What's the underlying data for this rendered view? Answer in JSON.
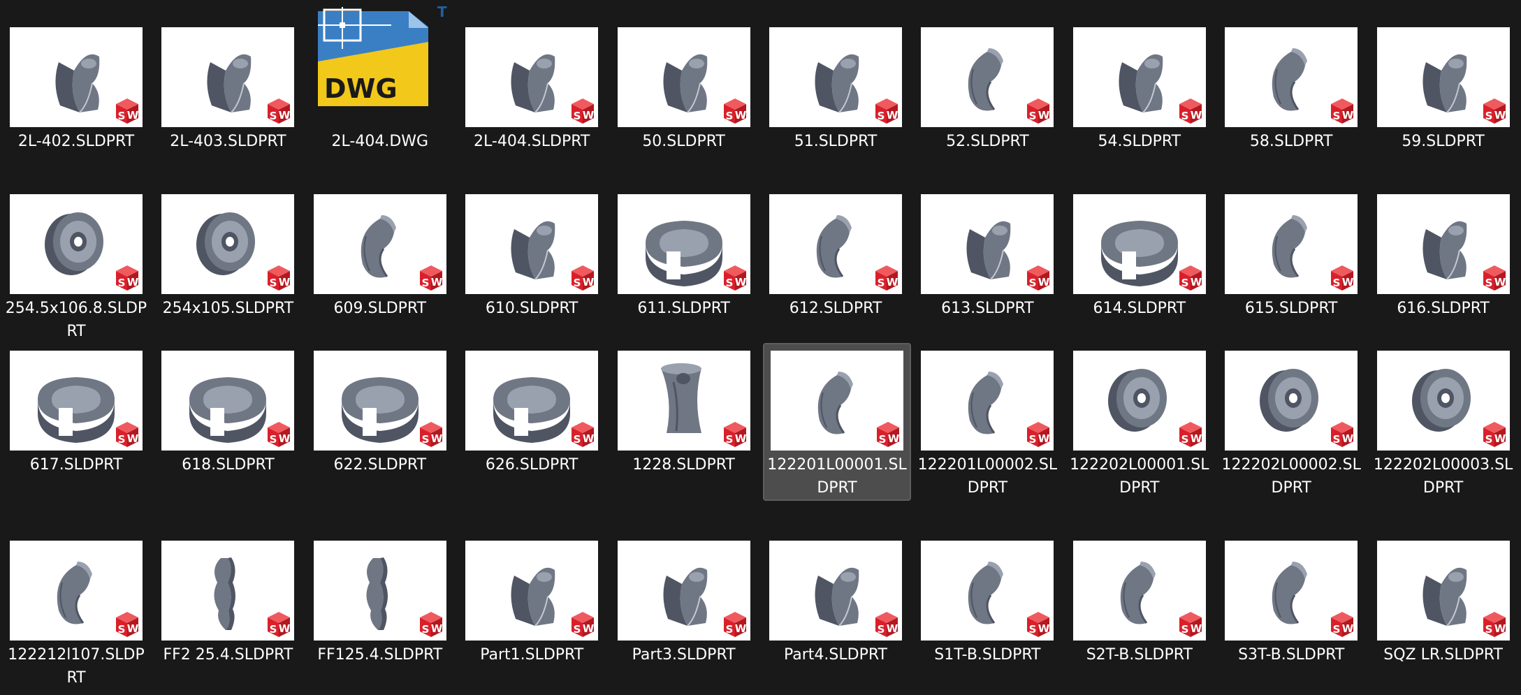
{
  "files": [
    {
      "name": "2L-402.SLDPRT",
      "type": "sw",
      "shape": "half",
      "selected": false
    },
    {
      "name": "2L-403.SLDPRT",
      "type": "sw",
      "shape": "half",
      "selected": false
    },
    {
      "name": "2L-404.DWG",
      "type": "dwg",
      "shape": "dwg",
      "selected": false
    },
    {
      "name": "2L-404.SLDPRT",
      "type": "sw",
      "shape": "half",
      "selected": false
    },
    {
      "name": "50.SLDPRT",
      "type": "sw",
      "shape": "half",
      "selected": false
    },
    {
      "name": "51.SLDPRT",
      "type": "sw",
      "shape": "half",
      "selected": false
    },
    {
      "name": "52.SLDPRT",
      "type": "sw",
      "shape": "crescent",
      "selected": false
    },
    {
      "name": "54.SLDPRT",
      "type": "sw",
      "shape": "half",
      "selected": false
    },
    {
      "name": "58.SLDPRT",
      "type": "sw",
      "shape": "crescent",
      "selected": false
    },
    {
      "name": "59.SLDPRT",
      "type": "sw",
      "shape": "half",
      "selected": false
    },
    {
      "name": "254.5x106.8.SLDPRT",
      "type": "sw",
      "shape": "wheel",
      "selected": false
    },
    {
      "name": "254x105.SLDPRT",
      "type": "sw",
      "shape": "wheel",
      "selected": false
    },
    {
      "name": "609.SLDPRT",
      "type": "sw",
      "shape": "crescent",
      "selected": false
    },
    {
      "name": "610.SLDPRT",
      "type": "sw",
      "shape": "half",
      "selected": false
    },
    {
      "name": "611.SLDPRT",
      "type": "sw",
      "shape": "cup",
      "selected": false
    },
    {
      "name": "612.SLDPRT",
      "type": "sw",
      "shape": "crescent",
      "selected": false
    },
    {
      "name": "613.SLDPRT",
      "type": "sw",
      "shape": "half",
      "selected": false
    },
    {
      "name": "614.SLDPRT",
      "type": "sw",
      "shape": "cup",
      "selected": false
    },
    {
      "name": "615.SLDPRT",
      "type": "sw",
      "shape": "crescent",
      "selected": false
    },
    {
      "name": "616.SLDPRT",
      "type": "sw",
      "shape": "half",
      "selected": false
    },
    {
      "name": "617.SLDPRT",
      "type": "sw",
      "shape": "cup",
      "selected": false
    },
    {
      "name": "618.SLDPRT",
      "type": "sw",
      "shape": "cup",
      "selected": false
    },
    {
      "name": "622.SLDPRT",
      "type": "sw",
      "shape": "cup",
      "selected": false
    },
    {
      "name": "626.SLDPRT",
      "type": "sw",
      "shape": "cup",
      "selected": false
    },
    {
      "name": "1228.SLDPRT",
      "type": "sw",
      "shape": "spool",
      "selected": false
    },
    {
      "name": "122201L00001.SLDPRT",
      "type": "sw",
      "shape": "crescent",
      "selected": true
    },
    {
      "name": "122201L00002.SLDPRT",
      "type": "sw",
      "shape": "crescent",
      "selected": false
    },
    {
      "name": "122202L00001.SLDPRT",
      "type": "sw",
      "shape": "wheel",
      "selected": false
    },
    {
      "name": "122202L00002.SLDPRT",
      "type": "sw",
      "shape": "wheel",
      "selected": false
    },
    {
      "name": "122202L00003.SLDPRT",
      "type": "sw",
      "shape": "wheel",
      "selected": false
    },
    {
      "name": "122212l107.SLDPRT",
      "type": "sw",
      "shape": "crescent",
      "selected": false
    },
    {
      "name": "FF2 25.4.SLDPRT",
      "type": "sw",
      "shape": "thin",
      "selected": false
    },
    {
      "name": "FF125.4.SLDPRT",
      "type": "sw",
      "shape": "thin",
      "selected": false
    },
    {
      "name": "Part1.SLDPRT",
      "type": "sw",
      "shape": "half",
      "selected": false
    },
    {
      "name": "Part3.SLDPRT",
      "type": "sw",
      "shape": "half",
      "selected": false
    },
    {
      "name": "Part4.SLDPRT",
      "type": "sw",
      "shape": "half",
      "selected": false
    },
    {
      "name": "S1T-B.SLDPRT",
      "type": "sw",
      "shape": "crescent",
      "selected": false
    },
    {
      "name": "S2T-B.SLDPRT",
      "type": "sw",
      "shape": "crescent",
      "selected": false
    },
    {
      "name": "S3T-B.SLDPRT",
      "type": "sw",
      "shape": "crescent",
      "selected": false
    },
    {
      "name": "SQZ LR.SLDPRT",
      "type": "sw",
      "shape": "half",
      "selected": false
    }
  ],
  "badges": {
    "sw_letters": "SW",
    "dwg_text": "DWG",
    "dwg_tm": "TM"
  },
  "colors": {
    "background": "#191919",
    "selection": "#4d4d4d",
    "badge_red": "#d9202a",
    "part_gray": "#6f7684",
    "dwg_yellow": "#f2c81a",
    "dwg_blue": "#1f5fa0"
  }
}
